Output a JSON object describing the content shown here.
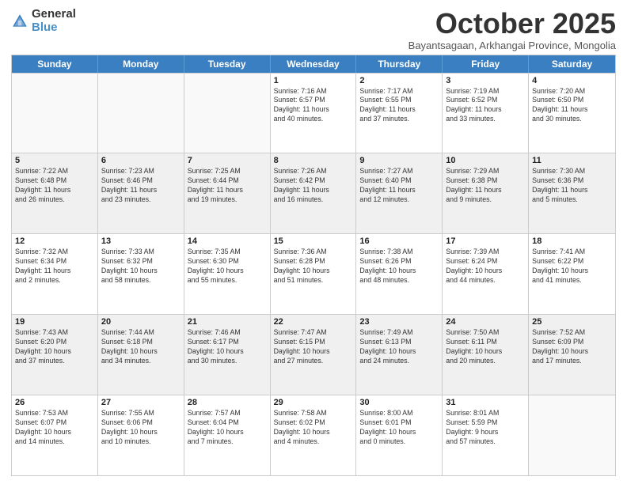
{
  "logo": {
    "general": "General",
    "blue": "Blue"
  },
  "title": "October 2025",
  "location": "Bayantsagaan, Arkhangai Province, Mongolia",
  "headers": [
    "Sunday",
    "Monday",
    "Tuesday",
    "Wednesday",
    "Thursday",
    "Friday",
    "Saturday"
  ],
  "weeks": [
    [
      {
        "day": "",
        "info": ""
      },
      {
        "day": "",
        "info": ""
      },
      {
        "day": "",
        "info": ""
      },
      {
        "day": "1",
        "info": "Sunrise: 7:16 AM\nSunset: 6:57 PM\nDaylight: 11 hours\nand 40 minutes."
      },
      {
        "day": "2",
        "info": "Sunrise: 7:17 AM\nSunset: 6:55 PM\nDaylight: 11 hours\nand 37 minutes."
      },
      {
        "day": "3",
        "info": "Sunrise: 7:19 AM\nSunset: 6:52 PM\nDaylight: 11 hours\nand 33 minutes."
      },
      {
        "day": "4",
        "info": "Sunrise: 7:20 AM\nSunset: 6:50 PM\nDaylight: 11 hours\nand 30 minutes."
      }
    ],
    [
      {
        "day": "5",
        "info": "Sunrise: 7:22 AM\nSunset: 6:48 PM\nDaylight: 11 hours\nand 26 minutes."
      },
      {
        "day": "6",
        "info": "Sunrise: 7:23 AM\nSunset: 6:46 PM\nDaylight: 11 hours\nand 23 minutes."
      },
      {
        "day": "7",
        "info": "Sunrise: 7:25 AM\nSunset: 6:44 PM\nDaylight: 11 hours\nand 19 minutes."
      },
      {
        "day": "8",
        "info": "Sunrise: 7:26 AM\nSunset: 6:42 PM\nDaylight: 11 hours\nand 16 minutes."
      },
      {
        "day": "9",
        "info": "Sunrise: 7:27 AM\nSunset: 6:40 PM\nDaylight: 11 hours\nand 12 minutes."
      },
      {
        "day": "10",
        "info": "Sunrise: 7:29 AM\nSunset: 6:38 PM\nDaylight: 11 hours\nand 9 minutes."
      },
      {
        "day": "11",
        "info": "Sunrise: 7:30 AM\nSunset: 6:36 PM\nDaylight: 11 hours\nand 5 minutes."
      }
    ],
    [
      {
        "day": "12",
        "info": "Sunrise: 7:32 AM\nSunset: 6:34 PM\nDaylight: 11 hours\nand 2 minutes."
      },
      {
        "day": "13",
        "info": "Sunrise: 7:33 AM\nSunset: 6:32 PM\nDaylight: 10 hours\nand 58 minutes."
      },
      {
        "day": "14",
        "info": "Sunrise: 7:35 AM\nSunset: 6:30 PM\nDaylight: 10 hours\nand 55 minutes."
      },
      {
        "day": "15",
        "info": "Sunrise: 7:36 AM\nSunset: 6:28 PM\nDaylight: 10 hours\nand 51 minutes."
      },
      {
        "day": "16",
        "info": "Sunrise: 7:38 AM\nSunset: 6:26 PM\nDaylight: 10 hours\nand 48 minutes."
      },
      {
        "day": "17",
        "info": "Sunrise: 7:39 AM\nSunset: 6:24 PM\nDaylight: 10 hours\nand 44 minutes."
      },
      {
        "day": "18",
        "info": "Sunrise: 7:41 AM\nSunset: 6:22 PM\nDaylight: 10 hours\nand 41 minutes."
      }
    ],
    [
      {
        "day": "19",
        "info": "Sunrise: 7:43 AM\nSunset: 6:20 PM\nDaylight: 10 hours\nand 37 minutes."
      },
      {
        "day": "20",
        "info": "Sunrise: 7:44 AM\nSunset: 6:18 PM\nDaylight: 10 hours\nand 34 minutes."
      },
      {
        "day": "21",
        "info": "Sunrise: 7:46 AM\nSunset: 6:17 PM\nDaylight: 10 hours\nand 30 minutes."
      },
      {
        "day": "22",
        "info": "Sunrise: 7:47 AM\nSunset: 6:15 PM\nDaylight: 10 hours\nand 27 minutes."
      },
      {
        "day": "23",
        "info": "Sunrise: 7:49 AM\nSunset: 6:13 PM\nDaylight: 10 hours\nand 24 minutes."
      },
      {
        "day": "24",
        "info": "Sunrise: 7:50 AM\nSunset: 6:11 PM\nDaylight: 10 hours\nand 20 minutes."
      },
      {
        "day": "25",
        "info": "Sunrise: 7:52 AM\nSunset: 6:09 PM\nDaylight: 10 hours\nand 17 minutes."
      }
    ],
    [
      {
        "day": "26",
        "info": "Sunrise: 7:53 AM\nSunset: 6:07 PM\nDaylight: 10 hours\nand 14 minutes."
      },
      {
        "day": "27",
        "info": "Sunrise: 7:55 AM\nSunset: 6:06 PM\nDaylight: 10 hours\nand 10 minutes."
      },
      {
        "day": "28",
        "info": "Sunrise: 7:57 AM\nSunset: 6:04 PM\nDaylight: 10 hours\nand 7 minutes."
      },
      {
        "day": "29",
        "info": "Sunrise: 7:58 AM\nSunset: 6:02 PM\nDaylight: 10 hours\nand 4 minutes."
      },
      {
        "day": "30",
        "info": "Sunrise: 8:00 AM\nSunset: 6:01 PM\nDaylight: 10 hours\nand 0 minutes."
      },
      {
        "day": "31",
        "info": "Sunrise: 8:01 AM\nSunset: 5:59 PM\nDaylight: 9 hours\nand 57 minutes."
      },
      {
        "day": "",
        "info": ""
      }
    ]
  ]
}
